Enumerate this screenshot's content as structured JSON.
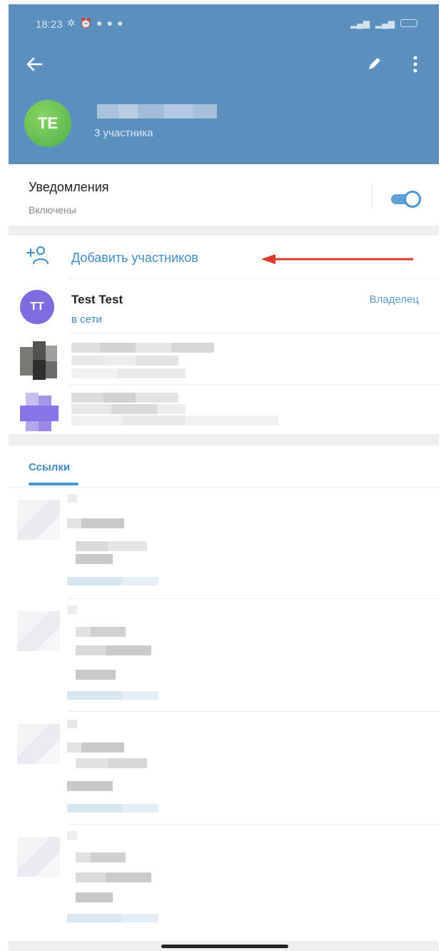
{
  "status_bar": {
    "time": "18:23",
    "left_icons": [
      "sync-off-icon",
      "alarm-icon",
      "dot-icon",
      "dot-icon",
      "dot-icon"
    ],
    "right_icons": [
      "signal-icon",
      "signal-icon",
      "battery-icon"
    ]
  },
  "header": {
    "avatar_initials": "TE",
    "members_count": "3 участника",
    "bg_color": "#5b8fbe",
    "avatar_color": "#5fbf4f"
  },
  "notifications": {
    "title": "Уведомления",
    "subtitle": "Включены",
    "enabled": true
  },
  "members": {
    "add_label": "Добавить участников",
    "items": [
      {
        "initials": "TT",
        "name": "Test Test",
        "status": "в сети",
        "role": "Владелец",
        "avatar_color": "#7e6ce0"
      }
    ]
  },
  "tabs": {
    "active": "Ссылки"
  },
  "colors": {
    "accent": "#3f8ccb",
    "annotation_arrow": "#d93a2b"
  }
}
